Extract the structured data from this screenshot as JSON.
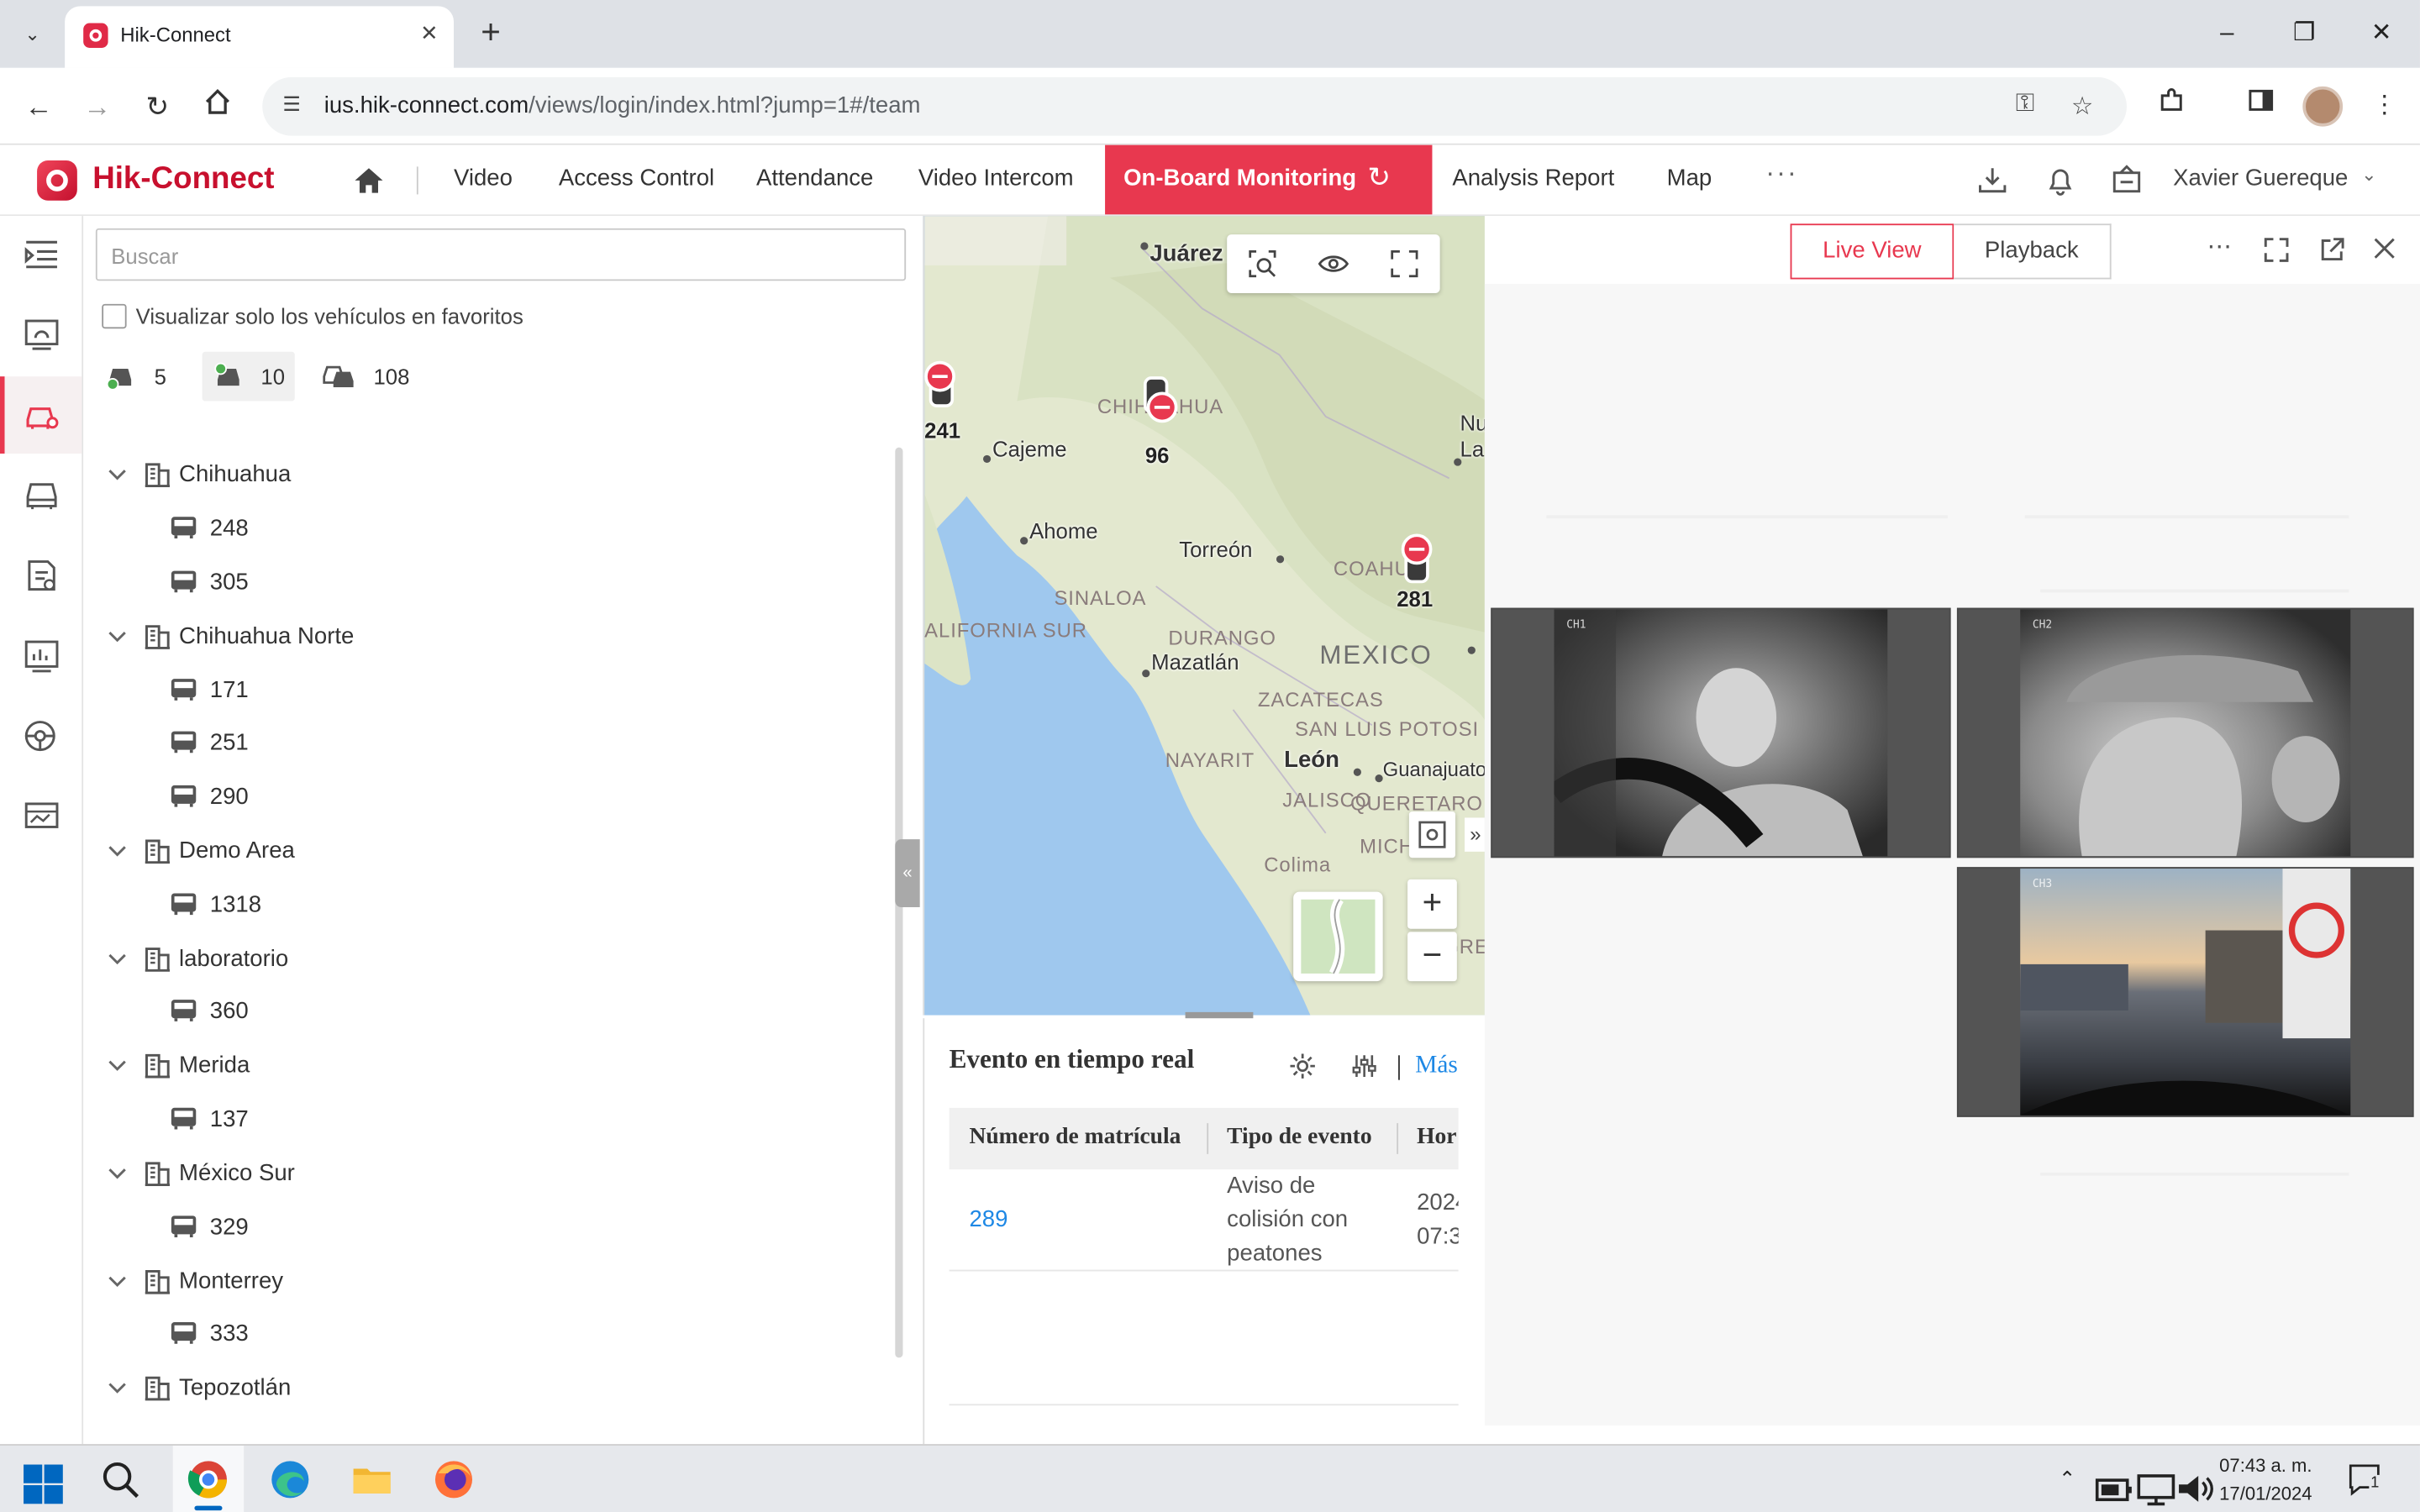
{
  "browser": {
    "tab_title": "Hik-Connect",
    "url_host": "ius.hik-connect.com",
    "url_path": "/views/login/index.html?jump=1#/team"
  },
  "header": {
    "brand": "Hik-Connect",
    "menu": [
      "Video",
      "Access Control",
      "Attendance",
      "Video Intercom"
    ],
    "active_menu": "On-Board Monitoring",
    "menu_after": [
      "Analysis Report",
      "Map"
    ],
    "more": "···",
    "user": "Xavier Guereque",
    "colors": {
      "accent": "#e8384f",
      "brand": "#c8102e"
    }
  },
  "rail": {
    "icons": [
      "menu-toggle-icon",
      "dashboard-icon",
      "vehicle-monitoring-icon",
      "vehicle-list-icon",
      "report-icon",
      "statistics-icon",
      "driving-behavior-icon",
      "screen-wall-icon"
    ],
    "active_index": 2
  },
  "tree": {
    "search_placeholder": "Buscar",
    "favorites_label": "Visualizar solo los vehículos en favoritos",
    "favorites_checked": false,
    "stats": [
      {
        "icon": "online-vehicle-icon",
        "count": "5"
      },
      {
        "icon": "moving-vehicle-icon",
        "count": "10"
      },
      {
        "icon": "all-vehicles-icon",
        "count": "108"
      }
    ],
    "groups": [
      {
        "name": "Chihuahua",
        "vehicles": [
          "248",
          "305"
        ]
      },
      {
        "name": "Chihuahua Norte",
        "vehicles": [
          "171",
          "251",
          "290"
        ]
      },
      {
        "name": "Demo Area",
        "vehicles": [
          "1318"
        ]
      },
      {
        "name": "laboratorio",
        "vehicles": [
          "360"
        ]
      },
      {
        "name": "Merida",
        "vehicles": [
          "137"
        ]
      },
      {
        "name": "México Sur",
        "vehicles": [
          "329"
        ]
      },
      {
        "name": "Monterrey",
        "vehicles": [
          "333"
        ]
      },
      {
        "name": "Tepozotlán",
        "vehicles": []
      }
    ]
  },
  "map": {
    "cities": [
      "Juárez",
      "Cajeme",
      "Ahome",
      "Torreón",
      "Mazatlán",
      "León",
      "Guanajuato",
      "Colima",
      "Nu",
      "La"
    ],
    "states": [
      "CHIHUAHUA",
      "SINALOA",
      "ALIFORNIA SUR",
      "DURANGO",
      "ZACATECAS",
      "SAN LUIS POTOSI",
      "NAYARIT",
      "JALISCO",
      "QUERETARO",
      "MICHOA",
      "COAHU",
      "GRE"
    ],
    "country": "MEXICO",
    "vehicle_markers": [
      "241",
      "96",
      "281"
    ],
    "zoom_in": "+",
    "zoom_out": "−"
  },
  "events": {
    "title": "Evento en tiempo real",
    "more": "Más",
    "columns": [
      "Número de matrícula",
      "Tipo de evento",
      "Hor"
    ],
    "rows": [
      {
        "plate": "289",
        "type_lines": [
          "Aviso de",
          "colisión con",
          "peatones"
        ],
        "time_lines": [
          "2024",
          "07:3"
        ]
      }
    ]
  },
  "liveview": {
    "tabs": [
      "Live View",
      "Playback"
    ],
    "active_tab": "Live View",
    "osd_texts": [
      "CH1",
      "CH2",
      "CH3"
    ]
  },
  "taskbar": {
    "time": "07:43 a. m.",
    "date": "17/01/2024",
    "notifications": "1"
  }
}
